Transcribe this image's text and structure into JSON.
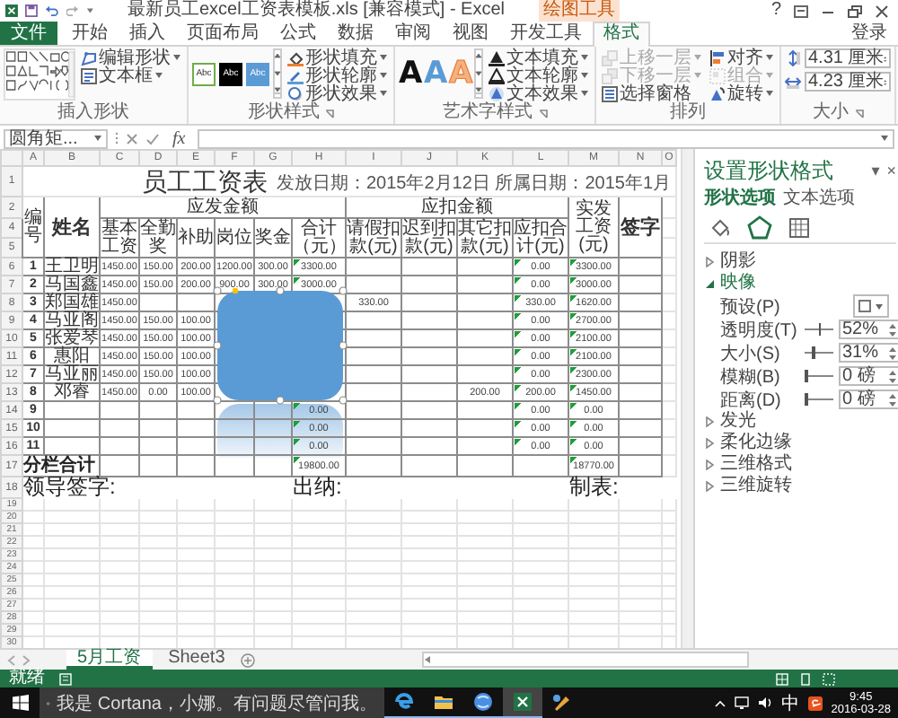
{
  "title_bar": {
    "title": "最新员工excel工资表模板.xls [兼容模式] - Excel",
    "context_label": "绘图工具",
    "help": "?"
  },
  "ribbon_tabs": [
    {
      "label": "文件",
      "kind": "file",
      "selected": false
    },
    {
      "label": "开始",
      "kind": "tab",
      "selected": false
    },
    {
      "label": "插入",
      "kind": "tab",
      "selected": false
    },
    {
      "label": "页面布局",
      "kind": "tab",
      "selected": false
    },
    {
      "label": "公式",
      "kind": "tab",
      "selected": false
    },
    {
      "label": "数据",
      "kind": "tab",
      "selected": false
    },
    {
      "label": "审阅",
      "kind": "tab",
      "selected": false
    },
    {
      "label": "视图",
      "kind": "tab",
      "selected": false
    },
    {
      "label": "开发工具",
      "kind": "tab",
      "selected": false
    },
    {
      "label": "格式",
      "kind": "tab",
      "selected": true
    }
  ],
  "account": "登录",
  "ribbon": {
    "insert_shapes": {
      "label": "插入形状",
      "commands": [
        {
          "label": "编辑形状",
          "kind": "edit-shape",
          "dropdown": true
        },
        {
          "label": "文本框",
          "kind": "text-box",
          "dropdown": true
        }
      ]
    },
    "shape_styles": {
      "label": "形状样式",
      "launcher": true,
      "presets": [
        {
          "label": "Abc",
          "kind": "outline"
        },
        {
          "label": "Abc",
          "kind": "dark"
        },
        {
          "label": "Abc",
          "kind": "accent"
        }
      ],
      "commands": [
        {
          "label": "形状填充",
          "kind": "fill",
          "dropdown": true
        },
        {
          "label": "形状轮廓",
          "kind": "outline",
          "dropdown": true
        },
        {
          "label": "形状效果",
          "kind": "effects",
          "dropdown": true
        }
      ]
    },
    "wordart_styles": {
      "label": "艺术字样式",
      "launcher": true,
      "presets": [
        {
          "label": "A",
          "kind": "plain"
        },
        {
          "label": "A",
          "kind": "accent"
        },
        {
          "label": "A",
          "kind": "orange"
        }
      ],
      "commands": [
        {
          "label": "文本填充",
          "kind": "text-fill",
          "dropdown": true
        },
        {
          "label": "文本轮廓",
          "kind": "text-outline",
          "dropdown": true
        },
        {
          "label": "文本效果",
          "kind": "text-effects",
          "dropdown": true
        }
      ]
    },
    "arrange": {
      "label": "排列",
      "commands": [
        {
          "label": "上移一层",
          "kind": "forward",
          "dropdown": true,
          "disabled": true
        },
        {
          "label": "下移一层",
          "kind": "backward",
          "dropdown": true,
          "disabled": true
        },
        {
          "label": "选择窗格",
          "kind": "pane",
          "dropdown": false,
          "disabled": false
        },
        {
          "label": "对齐",
          "kind": "align",
          "dropdown": true,
          "disabled": false
        },
        {
          "label": "组合",
          "kind": "group",
          "dropdown": true,
          "disabled": true
        },
        {
          "label": "旋转",
          "kind": "rotate",
          "dropdown": true,
          "disabled": false
        }
      ]
    },
    "size": {
      "label": "大小",
      "launcher": true,
      "fields": [
        {
          "value": "4.31 厘米",
          "kind": "height"
        },
        {
          "value": "4.23 厘米",
          "kind": "width"
        }
      ]
    }
  },
  "formula_bar": {
    "name_box": "圆角矩...",
    "function_label": "fx"
  },
  "sheet": {
    "columns": [
      "A",
      "B",
      "C",
      "D",
      "E",
      "F",
      "G",
      "H",
      "I",
      "J",
      "K",
      "L",
      "M",
      "N",
      "O"
    ],
    "title": {
      "row": "1",
      "text": "员工工资表",
      "note": "发放日期：2015年2月12日 所属日期：2015年1月"
    },
    "header": {
      "rows": [
        "2",
        "4",
        "5"
      ],
      "number": "编号",
      "name": "姓名",
      "gross": "应发金额",
      "gross_columns": [
        "基本工资",
        "全勤奖",
        "补助",
        "岗位",
        "奖金",
        "合计（元）"
      ],
      "deductions": "应扣金额",
      "deduction_columns": [
        "请假扣款(元)",
        "迟到扣款(元)",
        "其它扣款(元)",
        "应扣合计(元)"
      ],
      "net_pay": "实发工资(元)",
      "signature": "签字"
    },
    "rows": [
      {
        "row": "6",
        "kind": "data",
        "cells": {
          "A": {
            "text": "1",
            "flagged": false
          },
          "B": {
            "text": "王卫明",
            "flagged": false
          },
          "C": {
            "text": "1450.00",
            "flagged": false
          },
          "D": {
            "text": "150.00",
            "flagged": false
          },
          "E": {
            "text": "200.00",
            "flagged": false
          },
          "F": {
            "text": "1200.00",
            "flagged": false
          },
          "G": {
            "text": "300.00",
            "flagged": false
          },
          "H": {
            "text": "3300.00",
            "flagged": true
          },
          "L": {
            "text": "0.00",
            "flagged": true
          },
          "M": {
            "text": "3300.00",
            "flagged": true
          }
        }
      },
      {
        "row": "7",
        "kind": "data",
        "cells": {
          "A": {
            "text": "2",
            "flagged": false
          },
          "B": {
            "text": "马国鑫",
            "flagged": false
          },
          "C": {
            "text": "1450.00",
            "flagged": false
          },
          "D": {
            "text": "150.00",
            "flagged": false
          },
          "E": {
            "text": "200.00",
            "flagged": false
          },
          "F": {
            "text": "900.00",
            "flagged": false
          },
          "G": {
            "text": "300.00",
            "flagged": false
          },
          "H": {
            "text": "3000.00",
            "flagged": true
          },
          "L": {
            "text": "0.00",
            "flagged": true
          },
          "M": {
            "text": "3000.00",
            "flagged": true
          }
        }
      },
      {
        "row": "8",
        "kind": "data",
        "cells": {
          "A": {
            "text": "3",
            "flagged": false
          },
          "B": {
            "text": "郑国雄",
            "flagged": false
          },
          "C": {
            "text": "1450.00",
            "flagged": false
          },
          "I": {
            "text": "330.00",
            "flagged": false
          },
          "L": {
            "text": "330.00",
            "flagged": true
          },
          "M": {
            "text": "1620.00",
            "flagged": true
          }
        }
      },
      {
        "row": "9",
        "kind": "data",
        "cells": {
          "A": {
            "text": "4",
            "flagged": false
          },
          "B": {
            "text": "马亚阁",
            "flagged": false
          },
          "C": {
            "text": "1450.00",
            "flagged": false
          },
          "D": {
            "text": "150.00",
            "flagged": false
          },
          "E": {
            "text": "100.00",
            "flagged": false
          },
          "L": {
            "text": "0.00",
            "flagged": true
          },
          "M": {
            "text": "2700.00",
            "flagged": true
          }
        }
      },
      {
        "row": "10",
        "kind": "data",
        "cells": {
          "A": {
            "text": "5",
            "flagged": false
          },
          "B": {
            "text": "张爱琴",
            "flagged": false
          },
          "C": {
            "text": "1450.00",
            "flagged": false
          },
          "D": {
            "text": "150.00",
            "flagged": false
          },
          "E": {
            "text": "100.00",
            "flagged": false
          },
          "L": {
            "text": "0.00",
            "flagged": true
          },
          "M": {
            "text": "2100.00",
            "flagged": true
          }
        }
      },
      {
        "row": "11",
        "kind": "data",
        "cells": {
          "A": {
            "text": "6",
            "flagged": false
          },
          "B": {
            "text": "惠阳",
            "flagged": false
          },
          "C": {
            "text": "1450.00",
            "flagged": false
          },
          "D": {
            "text": "150.00",
            "flagged": false
          },
          "E": {
            "text": "100.00",
            "flagged": false
          },
          "L": {
            "text": "0.00",
            "flagged": true
          },
          "M": {
            "text": "2100.00",
            "flagged": true
          }
        }
      },
      {
        "row": "12",
        "kind": "data",
        "cells": {
          "A": {
            "text": "7",
            "flagged": false
          },
          "B": {
            "text": "马亚丽",
            "flagged": false
          },
          "C": {
            "text": "1450.00",
            "flagged": false
          },
          "D": {
            "text": "150.00",
            "flagged": false
          },
          "E": {
            "text": "100.00",
            "flagged": false
          },
          "L": {
            "text": "0.00",
            "flagged": true
          },
          "M": {
            "text": "2300.00",
            "flagged": true
          }
        }
      },
      {
        "row": "13",
        "kind": "data",
        "cells": {
          "A": {
            "text": "8",
            "flagged": false
          },
          "B": {
            "text": "邓睿",
            "flagged": false
          },
          "C": {
            "text": "1450.00",
            "flagged": false
          },
          "D": {
            "text": "0.00",
            "flagged": false
          },
          "E": {
            "text": "100.00",
            "flagged": false
          },
          "K": {
            "text": "200.00",
            "flagged": false
          },
          "L": {
            "text": "200.00",
            "flagged": true
          },
          "M": {
            "text": "1450.00",
            "flagged": true
          }
        }
      },
      {
        "row": "14",
        "kind": "data",
        "cells": {
          "A": {
            "text": "9",
            "flagged": false
          },
          "H": {
            "text": "0.00",
            "flagged": true
          },
          "L": {
            "text": "0.00",
            "flagged": true
          },
          "M": {
            "text": "0.00",
            "flagged": true
          }
        }
      },
      {
        "row": "15",
        "kind": "data",
        "cells": {
          "A": {
            "text": "10",
            "flagged": false
          },
          "H": {
            "text": "0.00",
            "flagged": true
          },
          "L": {
            "text": "0.00",
            "flagged": true
          },
          "M": {
            "text": "0.00",
            "flagged": true
          }
        }
      },
      {
        "row": "16",
        "kind": "data",
        "cells": {
          "A": {
            "text": "11",
            "flagged": false
          },
          "H": {
            "text": "0.00",
            "flagged": true
          },
          "L": {
            "text": "0.00",
            "flagged": true
          },
          "M": {
            "text": "0.00",
            "flagged": true
          }
        }
      },
      {
        "row": "17",
        "kind": "total",
        "cells": {
          "A": {
            "text": "分栏合计",
            "flagged": false
          },
          "H": {
            "text": "19800.00",
            "flagged": true
          },
          "M": {
            "text": "18770.00",
            "flagged": true
          }
        }
      },
      {
        "row": "18",
        "kind": "signature",
        "cells": {
          "A": {
            "text": "领导签字:"
          },
          "H": {
            "text": "出纳:"
          },
          "M": {
            "text": "制表:"
          }
        }
      },
      {
        "row": "19",
        "kind": "blank"
      },
      {
        "row": "20",
        "kind": "blank"
      },
      {
        "row": "21",
        "kind": "blank"
      },
      {
        "row": "22",
        "kind": "blank"
      },
      {
        "row": "23",
        "kind": "blank"
      },
      {
        "row": "24",
        "kind": "blank"
      },
      {
        "row": "25",
        "kind": "blank"
      },
      {
        "row": "26",
        "kind": "blank"
      },
      {
        "row": "27",
        "kind": "blank"
      },
      {
        "row": "28",
        "kind": "blank"
      },
      {
        "row": "29",
        "kind": "blank"
      },
      {
        "row": "30",
        "kind": "blank"
      }
    ],
    "shape": {
      "kind": "rounded-rectangle",
      "selected": true,
      "reflection": true
    }
  },
  "format_pane": {
    "title": "设置形状格式",
    "menu": "▾",
    "close": "×",
    "tabs": [
      {
        "label": "形状选项",
        "selected": true
      },
      {
        "label": "文本选项",
        "selected": false
      }
    ],
    "categories": [
      {
        "kind": "fill",
        "selected": false
      },
      {
        "kind": "effects",
        "selected": true
      },
      {
        "kind": "size",
        "selected": false
      }
    ],
    "sections": [
      {
        "label": "阴影",
        "expanded": false
      },
      {
        "label": "映像",
        "expanded": true,
        "controls": [
          {
            "kind": "preset",
            "label": "预设(P)"
          },
          {
            "kind": "slider",
            "label": "透明度(T)",
            "level": 0.52,
            "value": "52%"
          },
          {
            "kind": "slider",
            "label": "大小(S)",
            "level": 0.31,
            "value": "31%"
          },
          {
            "kind": "slider",
            "label": "模糊(B)",
            "level": 0,
            "value": "0 磅"
          },
          {
            "kind": "slider",
            "label": "距离(D)",
            "level": 0,
            "value": "0 磅"
          }
        ]
      },
      {
        "label": "发光",
        "expanded": false
      },
      {
        "label": "柔化边缘",
        "expanded": false
      },
      {
        "label": "三维格式",
        "expanded": false
      },
      {
        "label": "三维旋转",
        "expanded": false
      }
    ]
  },
  "sheet_tabs": [
    {
      "label": "5月工资",
      "selected": true
    },
    {
      "label": "Sheet3",
      "selected": false
    }
  ],
  "status": "就绪",
  "taskbar": {
    "search": "我是 Cortana，小娜。有问题尽管问我。",
    "apps": [
      {
        "kind": "edge",
        "running": true,
        "active": false
      },
      {
        "kind": "explorer",
        "running": true,
        "active": false
      },
      {
        "kind": "globe",
        "running": true,
        "active": false
      },
      {
        "kind": "excel",
        "running": true,
        "active": true
      },
      {
        "kind": "paint",
        "running": false,
        "active": false
      }
    ],
    "ime": "中",
    "time": "9:45",
    "date": "2016-03-28"
  }
}
